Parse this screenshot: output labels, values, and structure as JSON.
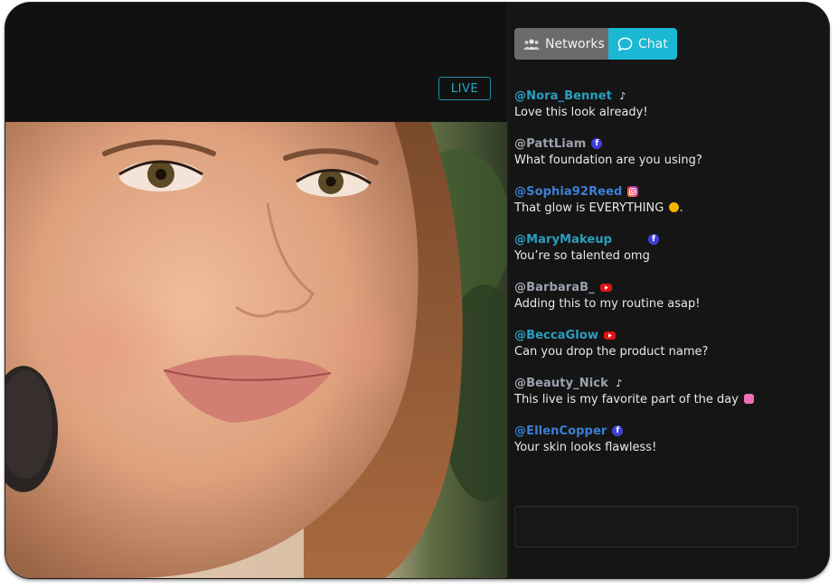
{
  "live_badge": "LIVE",
  "tabs": {
    "networks_label": "Networks",
    "chat_label": "Chat"
  },
  "colors": {
    "accent": "#1ab8d4",
    "networks_tab": "#6b6b6b",
    "background": "#111111"
  },
  "messages": [
    {
      "user": "@Nora_Bennet",
      "network": "tiktok-icon",
      "text": "Love this look already!"
    },
    {
      "user": "@PattLiam",
      "network": "facebook-icon",
      "text": "What foundation are you using?"
    },
    {
      "user": "@Sophia92Reed",
      "network": "instagram-icon",
      "text": "That glow is EVERYTHING",
      "emoji": "heart-eyes-emoji",
      "suffix": "."
    },
    {
      "user": "@MaryMakeup",
      "network": "facebook-icon",
      "text": "You’re so talented omg"
    },
    {
      "user": "@BarbaraB_",
      "network": "youtube-icon",
      "text": "Adding this to my routine asap!"
    },
    {
      "user": "@BeccaGlow",
      "network": "youtube-icon",
      "text": "Can you drop the product name?"
    },
    {
      "user": "@Beauty_Nick",
      "network": "tiktok-icon",
      "text": "This live is my favorite part of the day",
      "emoji": "sparkling-heart-emoji"
    },
    {
      "user": "@EllenCopper",
      "network": "facebook-icon",
      "text": "Your skin looks flawless!"
    }
  ],
  "chat_input": {
    "value": "",
    "placeholder": ""
  }
}
